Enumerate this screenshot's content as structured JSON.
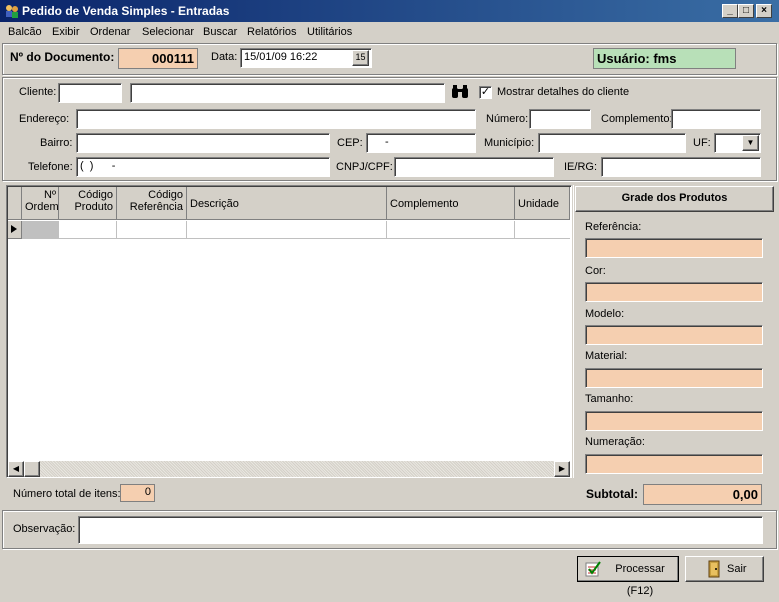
{
  "window": {
    "title": "Pedido de Venda Simples - Entradas"
  },
  "menu": [
    {
      "label": "Balcão"
    },
    {
      "label": "Exibir"
    },
    {
      "label": "Ordenar"
    },
    {
      "label": "Selecionar"
    },
    {
      "label": "Buscar"
    },
    {
      "label": "Relatórios"
    },
    {
      "label": "Utilitários"
    }
  ],
  "header": {
    "doc_label": "Nº do Documento:",
    "doc_value": "000111",
    "date_label": "Data:",
    "date_value": "15/01/09 16:22",
    "user_value": "Usuário: fms"
  },
  "client": {
    "cliente_label": "Cliente:",
    "mostrar_label": "Mostrar detalhes do cliente",
    "mostrar_checked": true,
    "endereco_label": "Endereço:",
    "numero_label": "Número:",
    "complemento_label": "Complemento:",
    "bairro_label": "Bairro:",
    "cep_label": "CEP:",
    "cep_value": "-",
    "municipio_label": "Município:",
    "uf_label": "UF:",
    "telefone_label": "Telefone:",
    "telefone_value": "(  )      -",
    "cnpj_label": "CNPJ/CPF:",
    "ie_label": "IE/RG:"
  },
  "grid": {
    "columns": [
      "Nº Ordem",
      "Código Produto",
      "Código Referência",
      "Descrição",
      "Complemento",
      "Unidade"
    ]
  },
  "grade": {
    "title": "Grade dos Produtos",
    "fields": [
      "Referência:",
      "Cor:",
      "Modelo:",
      "Material:",
      "Tamanho:",
      "Numeração:"
    ]
  },
  "totals": {
    "itens_label": "Número total de itens:",
    "itens_value": "0",
    "subtotal_label": "Subtotal:",
    "subtotal_value": "0,00"
  },
  "obs": {
    "label": "Observação:"
  },
  "buttons": {
    "processar": "Processar (F12)",
    "sair": "Sair"
  }
}
